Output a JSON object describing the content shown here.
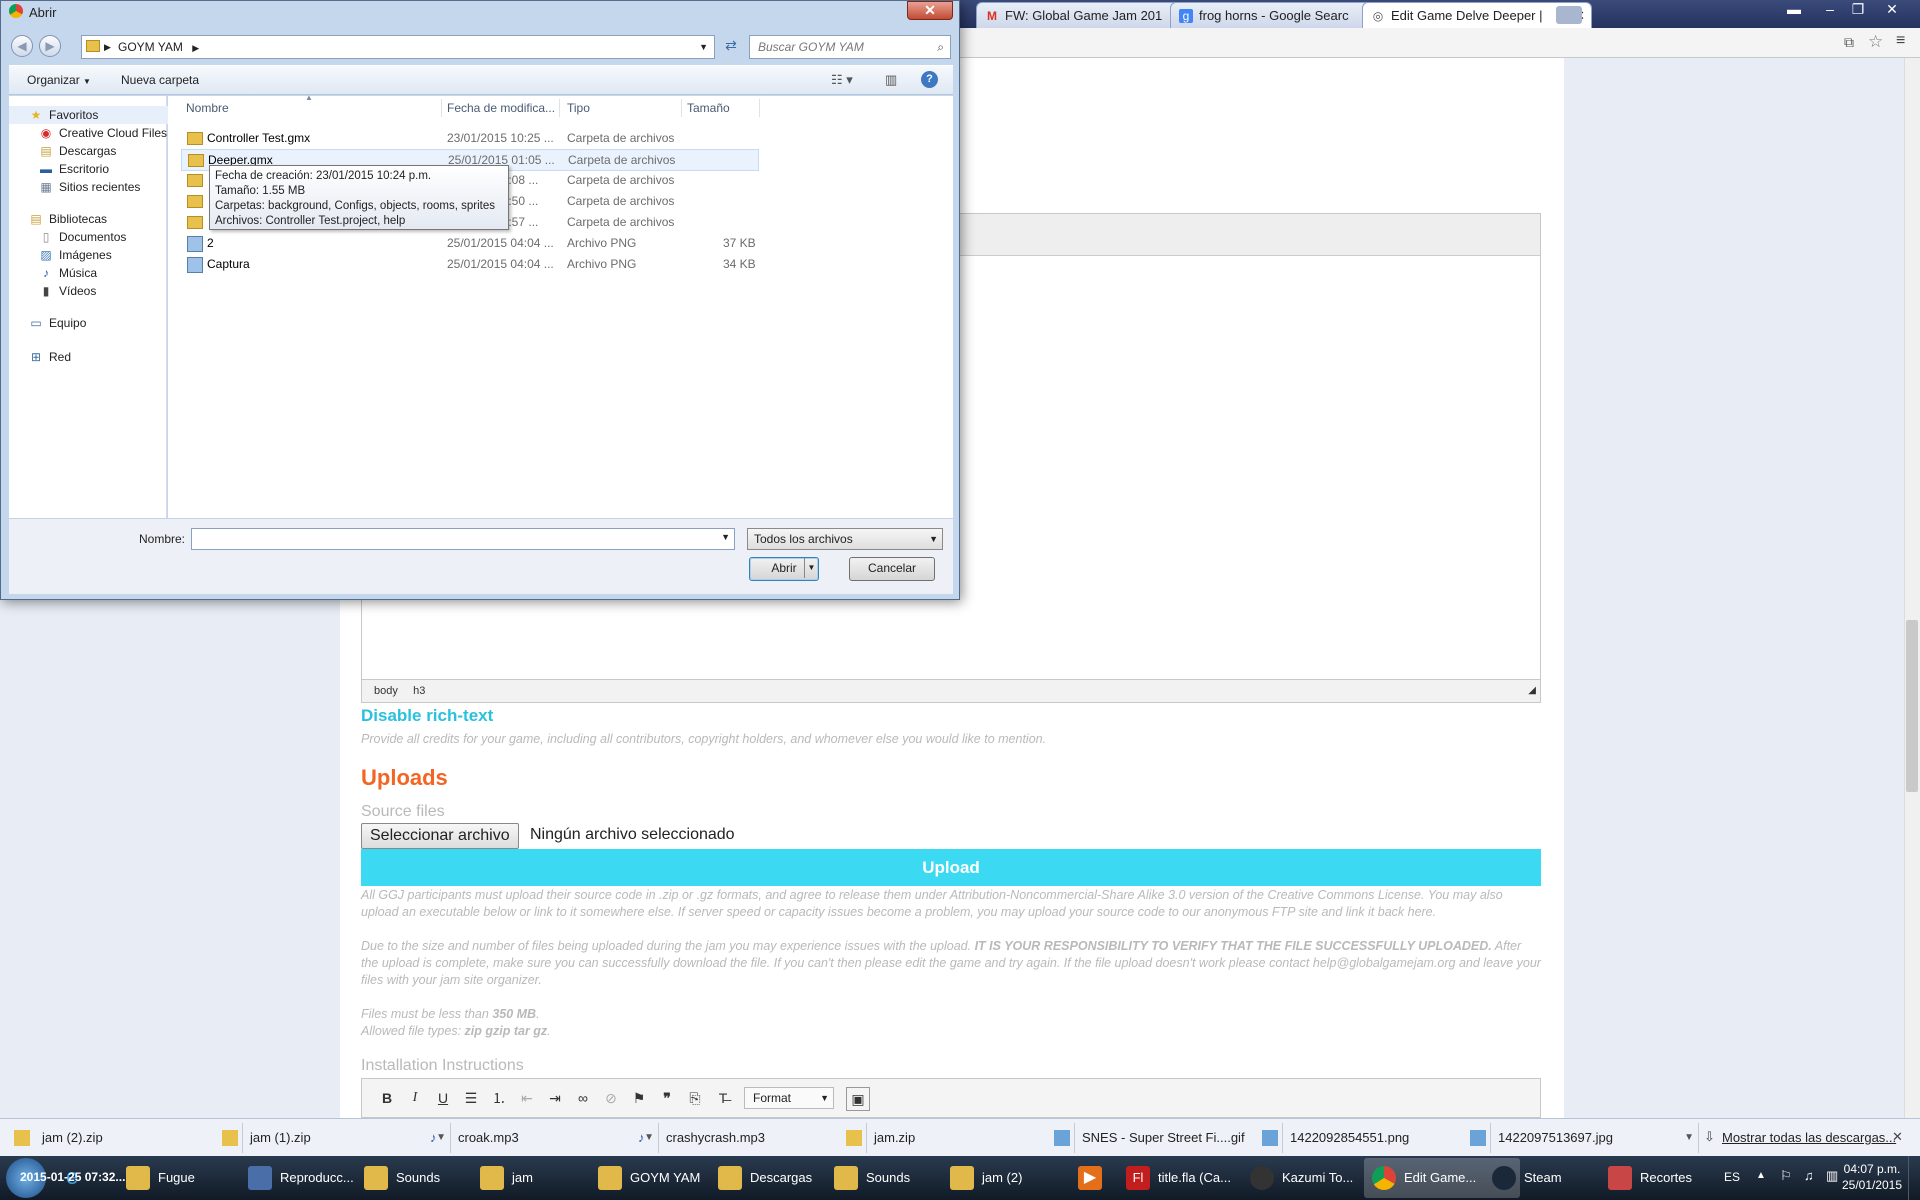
{
  "browser": {
    "tabs": [
      {
        "label": "FW: Global Game Jam 201",
        "icon": "gmail-icon"
      },
      {
        "label": "frog horns - Google Searc",
        "icon": "google-icon"
      },
      {
        "label": "Edit Game Delve Deeper |",
        "icon": "globe-icon"
      }
    ]
  },
  "page": {
    "editor_path": [
      "body",
      "h3"
    ],
    "disable_richtext": "Disable rich-text",
    "credits_help": "Provide all credits for your game, including all contributors, copyright holders, and whomever else you would like to mention.",
    "uploads_heading": "Uploads",
    "source_files_label": "Source files",
    "file_button": "Seleccionar archivo",
    "file_none": "Ningún archivo seleccionado",
    "upload_button": "Upload",
    "upload_help1": "All GGJ participants must upload their source code in .zip or .gz formats, and agree to release them under Attribution-Noncommercial-Share Alike 3.0 version of the Creative Commons License. You may also upload an executable below or link to it somewhere else. If server speed or capacity issues become a problem, you may upload your source code to our anonymous FTP site and link it back here.",
    "upload_help2_a": "Due to the size and number of files being uploaded during the jam you may experience issues with the upload. ",
    "upload_help2_b": "IT IS YOUR RESPONSIBILITY TO VERIFY THAT THE FILE SUCCESSFULLY UPLOADED.",
    "upload_help2_c": " After the upload is complete, make sure you can successfully download the file. If you can't then please edit the game and try again. If the file upload doesn't work please contact help@globalgamejam.org and leave your files with your jam site organizer.",
    "files_less_a": "Files must be less than ",
    "files_less_b": "350 MB",
    "files_less_c": ".",
    "allowed_a": "Allowed file types: ",
    "allowed_b": "zip gzip tar gz",
    "allowed_c": ".",
    "install_label": "Installation Instructions",
    "format_select": "Format"
  },
  "dialog": {
    "title": "Abrir",
    "address_path": "GOYM YAM",
    "search_placeholder": "Buscar GOYM YAM",
    "organize": "Organizar",
    "new_folder": "Nueva carpeta",
    "nav": {
      "favorites": "Favoritos",
      "favorite_items": [
        "Creative Cloud Files",
        "Descargas",
        "Escritorio",
        "Sitios recientes"
      ],
      "libraries": "Bibliotecas",
      "library_items": [
        "Documentos",
        "Imágenes",
        "Música",
        "Vídeos"
      ],
      "computer": "Equipo",
      "network": "Red"
    },
    "columns": [
      "Nombre",
      "Fecha de modifica...",
      "Tipo",
      "Tamaño"
    ],
    "files": [
      {
        "name": "Controller Test.gmx",
        "date": "23/01/2015 10:25 ...",
        "type": "Carpeta de archivos",
        "size": ""
      },
      {
        "name": "Deeper.gmx",
        "date": "25/01/2015 01:05 ...",
        "type": "Carpeta de archivos",
        "size": ""
      },
      {
        "name": "",
        "date": "02:08 ...",
        "type": "Carpeta de archivos",
        "size": ""
      },
      {
        "name": "",
        "date": "03:50 ...",
        "type": "Carpeta de archivos",
        "size": ""
      },
      {
        "name": "",
        "date": "08:57 ...",
        "type": "Carpeta de archivos",
        "size": ""
      },
      {
        "name": "2",
        "date": "25/01/2015 04:04 ...",
        "type": "Archivo PNG",
        "size": "37 KB"
      },
      {
        "name": "Captura",
        "date": "25/01/2015 04:04 ...",
        "type": "Archivo PNG",
        "size": "34 KB"
      }
    ],
    "tooltip": [
      "Fecha de creación: 23/01/2015 10:24 p.m.",
      "Tamaño: 1.55 MB",
      "Carpetas: background, Configs, objects, rooms, sprites",
      "Archivos: Controller Test.project, help"
    ],
    "filename_label": "Nombre:",
    "filename_value": "",
    "filter": "Todos los archivos",
    "open": "Abrir",
    "cancel": "Cancelar"
  },
  "downloads": {
    "items": [
      "jam (2).zip",
      "jam (1).zip",
      "croak.mp3",
      "crashycrash.mp3",
      "jam.zip",
      "SNES - Super Street Fi....gif",
      "1422092854551.png",
      "1422097513697.jpg"
    ],
    "show_all": "Mostrar todas las descargas..."
  },
  "taskbar": {
    "items": [
      "Fugue",
      "Reproducc...",
      "Sounds",
      "jam",
      "GOYM YAM",
      "Descargas",
      "Sounds",
      "jam (2)",
      "",
      "title.fla (Ca...",
      "Kazumi To...",
      "Edit Game...",
      "Steam",
      "Recortes"
    ],
    "overlay_text": "2015-01-25 07:32...",
    "lang": "ES",
    "time": "04:07 p.m.",
    "date": "25/01/2015"
  },
  "colors": {
    "accent_cyan": "#3cdaf2",
    "heading_orange": "#f26522"
  }
}
